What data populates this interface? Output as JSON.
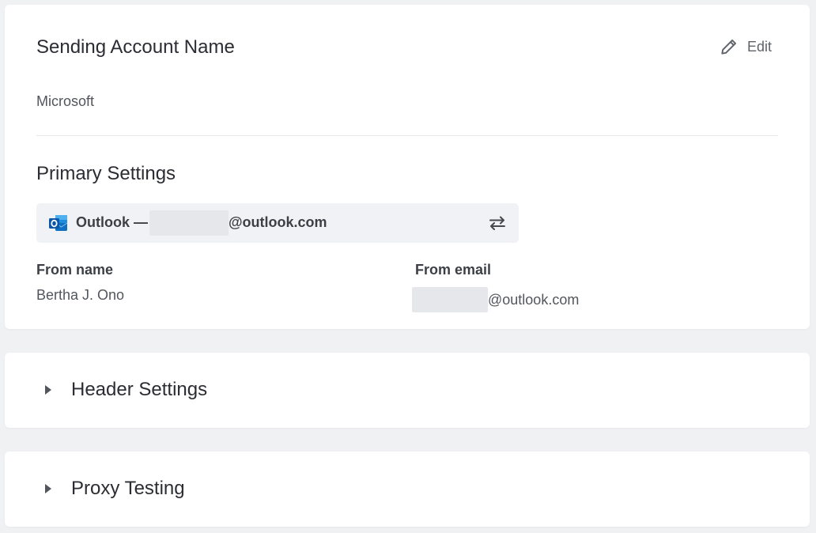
{
  "sending_account": {
    "title": "Sending Account Name",
    "edit_label": "Edit",
    "value": "Microsoft"
  },
  "primary_settings": {
    "title": "Primary Settings",
    "connection": {
      "provider_prefix": "Outlook —",
      "email_domain": "@outlook.com"
    },
    "from_name": {
      "label": "From name",
      "value": "Bertha J. Ono"
    },
    "from_email": {
      "label": "From email",
      "email_domain": "@outlook.com"
    }
  },
  "sections": {
    "header_settings": "Header Settings",
    "proxy_testing": "Proxy Testing"
  },
  "colors": {
    "background": "#f0f1f3",
    "card": "#ffffff",
    "connection_box": "#f1f2f6",
    "outlook_blue": "#0a64c8",
    "redaction": "#e6e7ea"
  },
  "icons": {
    "edit": "pencil-icon",
    "provider": "outlook-icon",
    "switch": "swap-arrows-icon",
    "expand": "caret-right-icon"
  }
}
